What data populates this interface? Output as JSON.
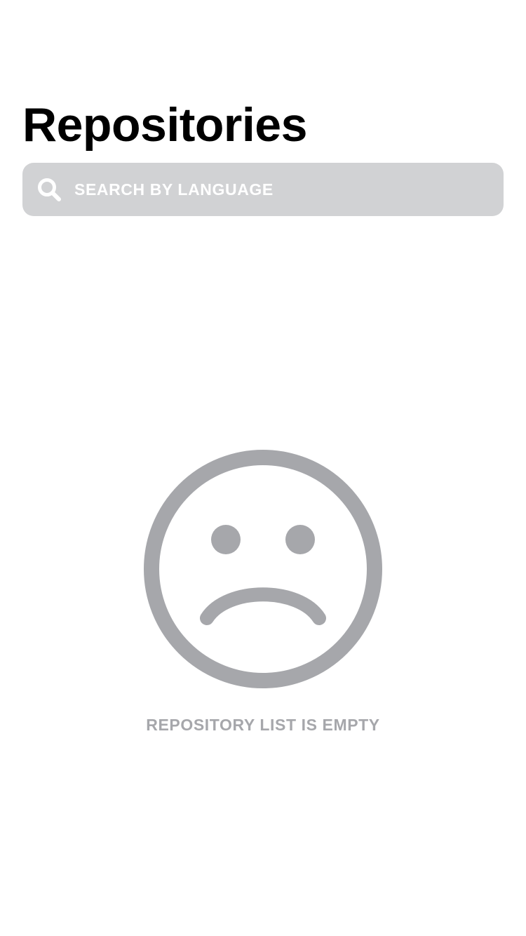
{
  "header": {
    "title": "Repositories"
  },
  "search": {
    "placeholder": "SEARCH BY LANGUAGE",
    "value": "",
    "icon": "search-icon"
  },
  "empty_state": {
    "icon": "sad-face-icon",
    "message": "REPOSITORY LIST IS EMPTY"
  },
  "colors": {
    "background": "#ffffff",
    "title_text": "#000000",
    "search_bar_background": "#d1d2d4",
    "search_text": "#ffffff",
    "empty_icon": "#a6a7ab",
    "empty_text": "#a6a7ab"
  }
}
